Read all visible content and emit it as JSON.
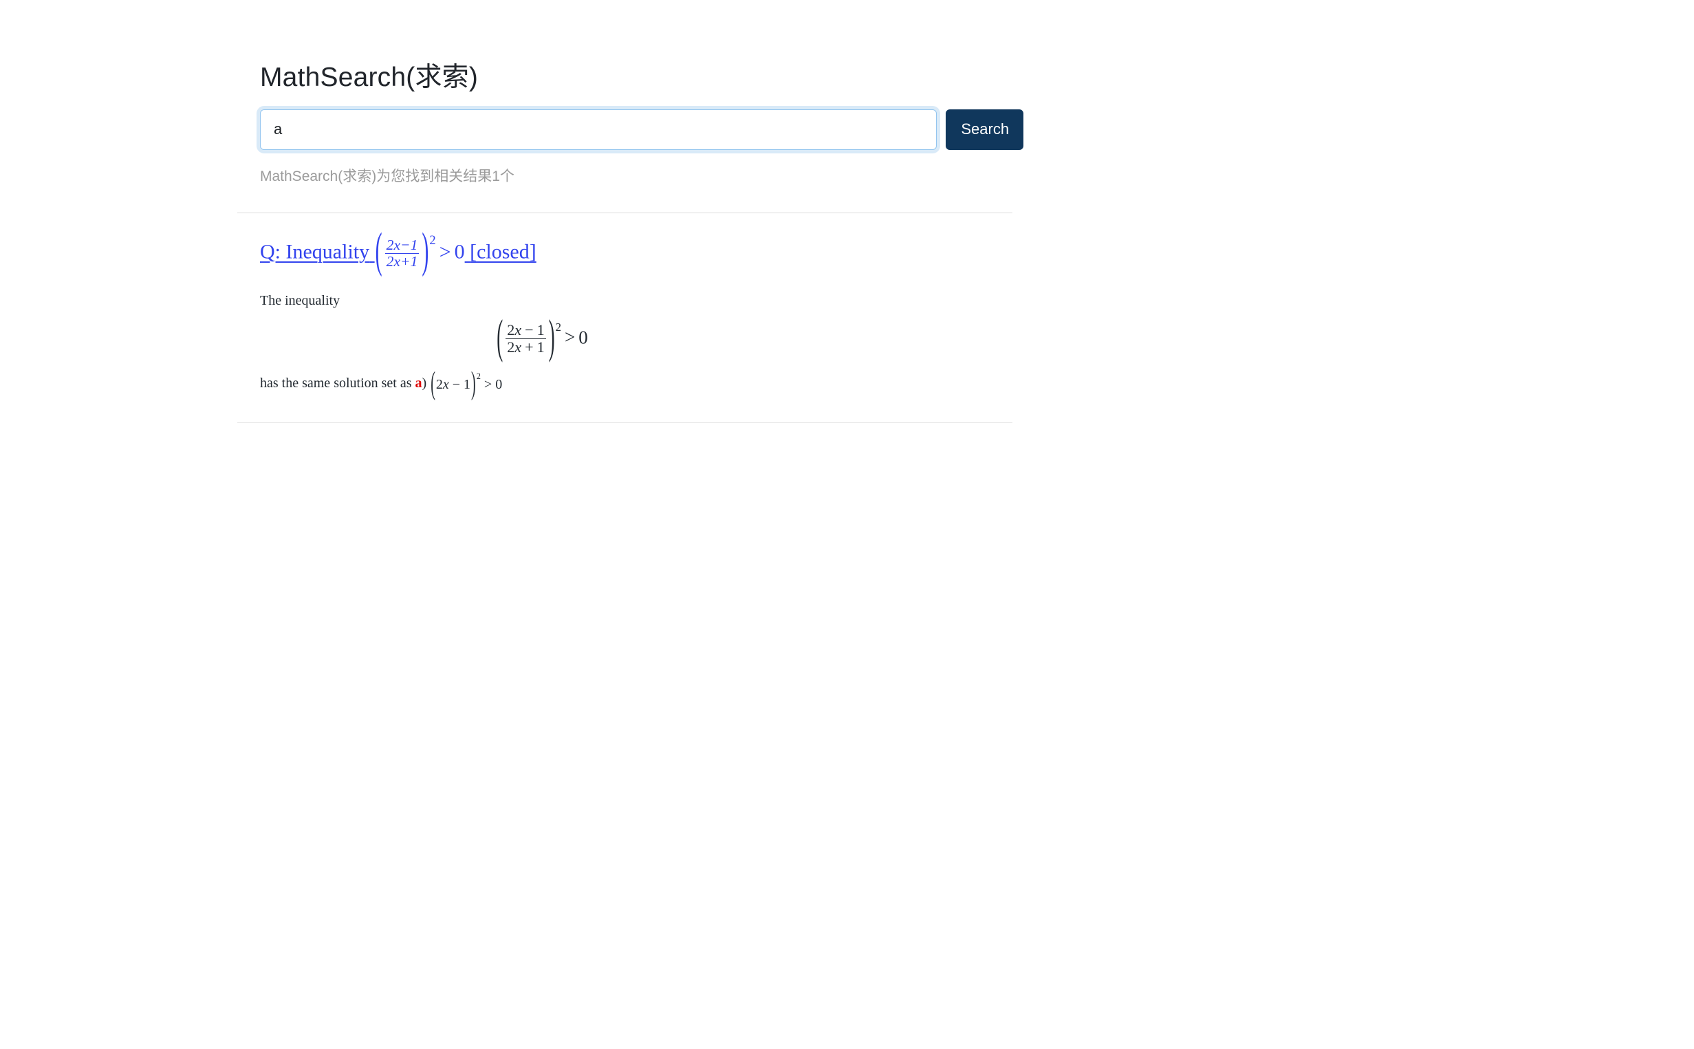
{
  "app": {
    "title": "MathSearch(求索)"
  },
  "search": {
    "value": "a",
    "placeholder": "",
    "button_label": "Search",
    "button_color": "#10375c",
    "input_border_color": "#93c5ef"
  },
  "status": {
    "result_count_text": "MathSearch(求索)为您找到相关结果1个",
    "count": 1,
    "color": "#9b9b9b"
  },
  "results": [
    {
      "title_prefix": "Q: Inequality",
      "title_math": {
        "numerator": "2x−1",
        "denominator": "2x+1",
        "exponent": "2",
        "relation": ">",
        "rhs": "0"
      },
      "title_suffix": "[closed]",
      "title_color": "#3344ee",
      "snippet_before": "The inequality",
      "display_math": {
        "numerator_n": "2",
        "numerator_var": "x",
        "numerator_op": "−",
        "numerator_const": "1",
        "denominator_n": "2",
        "denominator_var": "x",
        "denominator_op": "+",
        "denominator_const": "1",
        "exponent": "2",
        "relation": ">",
        "rhs": "0"
      },
      "snippet_after_text": "has the same solution set as",
      "highlight_term": "a",
      "highlight_color": "#dd0000",
      "snippet_after_paren": ")",
      "snippet_after_math": {
        "open": "(",
        "coef": "2",
        "var": "x",
        "op": "−",
        "const": "1",
        "close": ")",
        "exponent": "2",
        "relation": ">",
        "rhs": "0"
      }
    }
  ]
}
